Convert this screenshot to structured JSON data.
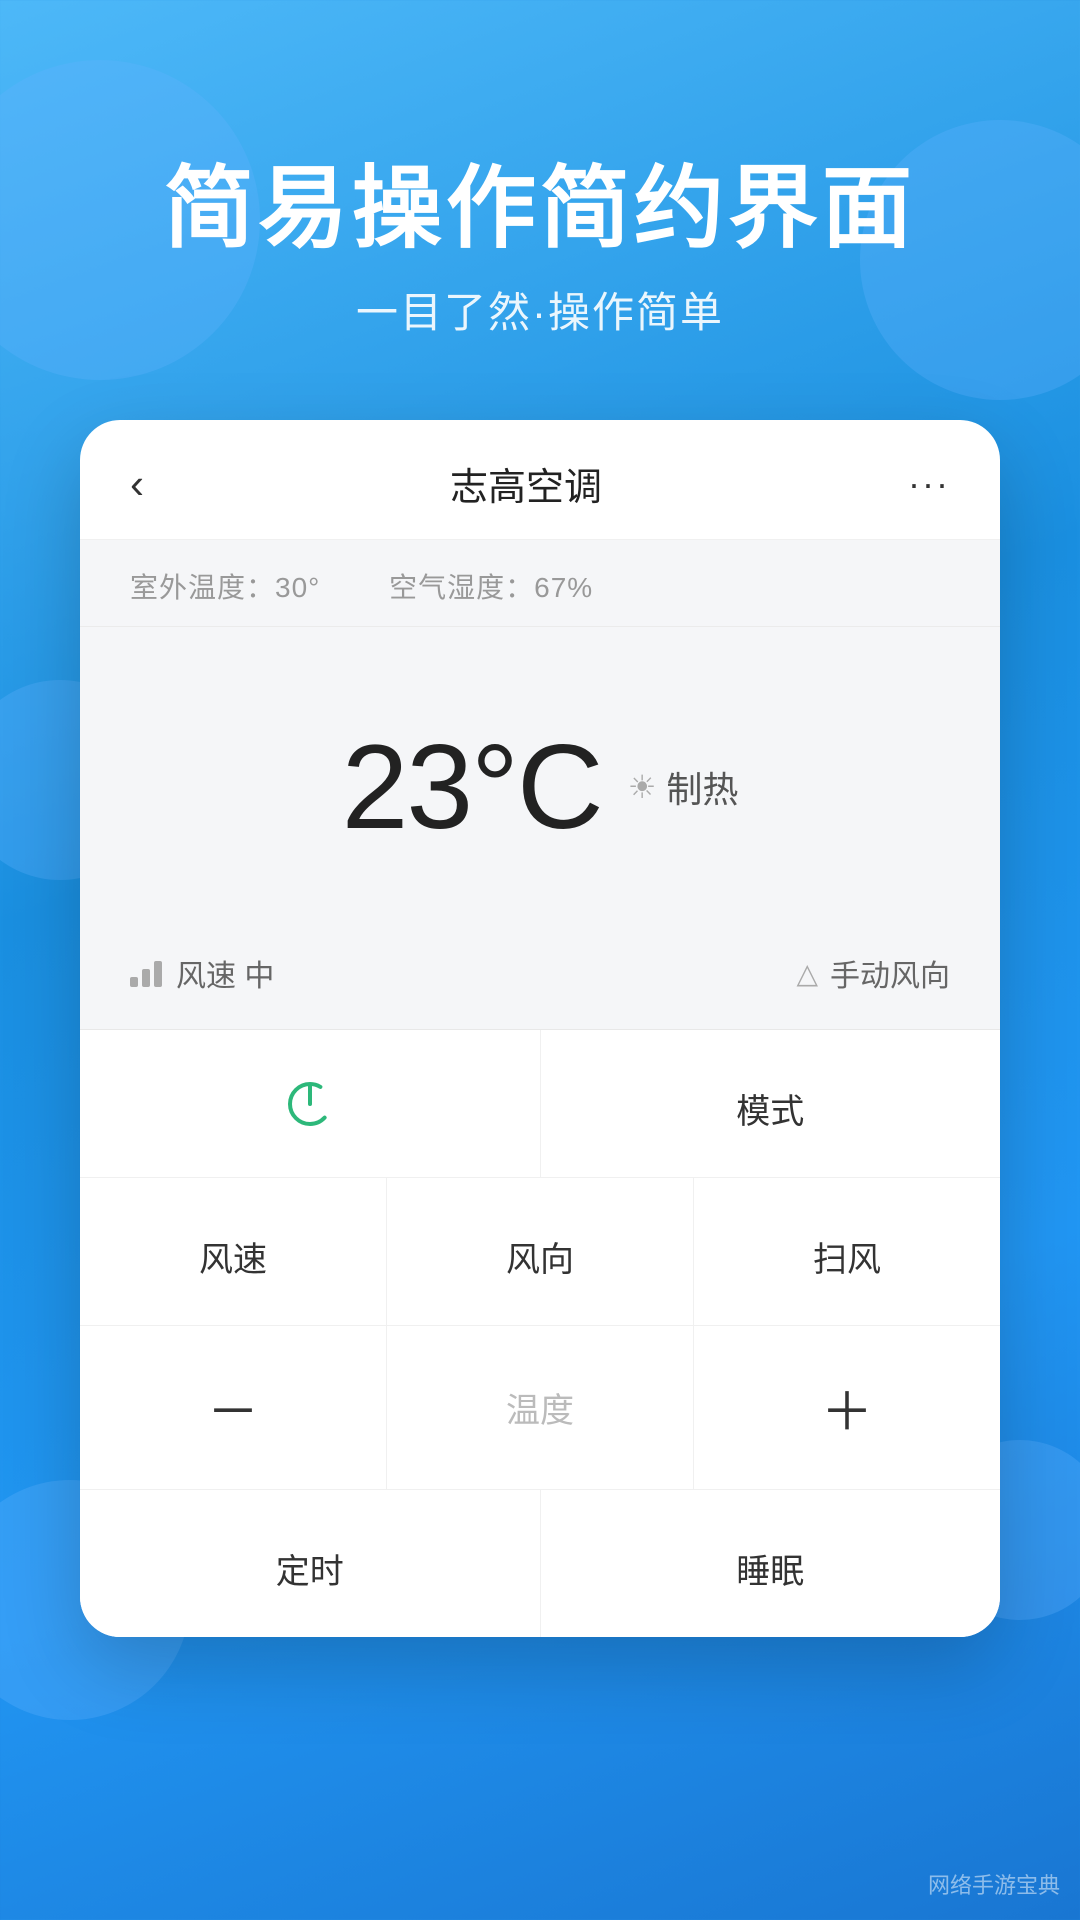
{
  "background": {
    "gradient_start": "#4db8f8",
    "gradient_end": "#1976d2"
  },
  "header": {
    "main_title": "简易操作简约界面",
    "sub_title": "一目了然·操作简单"
  },
  "card": {
    "back_label": "‹",
    "title": "志高空调",
    "more_label": "···",
    "weather": {
      "outdoor_temp_label": "室外温度：30°",
      "humidity_label": "空气湿度：67%"
    },
    "temperature": {
      "value": "23°C",
      "mode_icon": "☀",
      "mode_label": "制热"
    },
    "fan": {
      "speed_label": "风速 中",
      "direction_label": "手动风向"
    },
    "controls": {
      "row1": [
        {
          "id": "power",
          "label": "",
          "has_icon": true
        },
        {
          "id": "mode",
          "label": "模式",
          "has_icon": false
        }
      ],
      "row2": [
        {
          "id": "fan-speed",
          "label": "风速"
        },
        {
          "id": "wind-dir",
          "label": "风向"
        },
        {
          "id": "sweep",
          "label": "扫风"
        }
      ],
      "row3": [
        {
          "id": "temp-minus",
          "label": "－"
        },
        {
          "id": "temp-label",
          "label": "温度"
        },
        {
          "id": "temp-plus",
          "label": "＋"
        }
      ],
      "row4": [
        {
          "id": "timer",
          "label": "定时"
        },
        {
          "id": "sleep",
          "label": "睡眠"
        }
      ]
    }
  },
  "watermark": "网络手游宝典"
}
